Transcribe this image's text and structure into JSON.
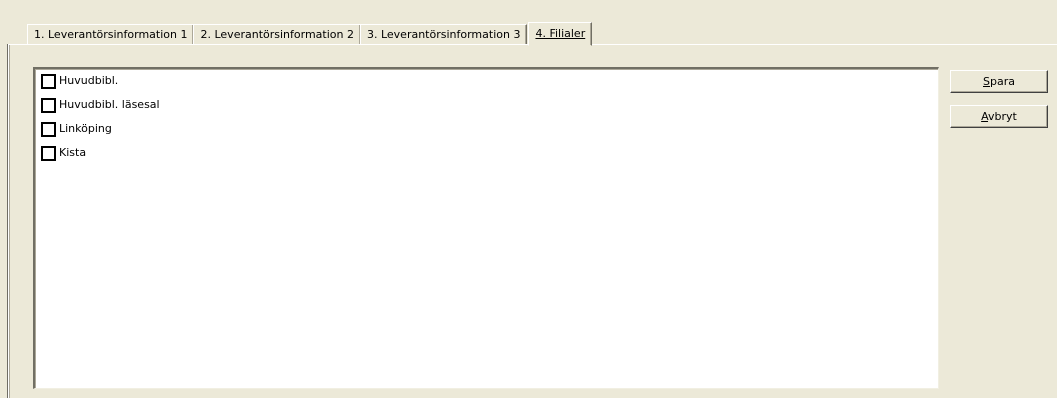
{
  "tabs": [
    {
      "label": "1. Leverantörsinformation 1",
      "active": false
    },
    {
      "label": "2. Leverantörsinformation 2",
      "active": false
    },
    {
      "label": "3. Leverantörsinformation 3",
      "active": false
    },
    {
      "label": "4. Filialer",
      "active": true
    }
  ],
  "branches": [
    {
      "label": "Huvudbibl.",
      "checked": false
    },
    {
      "label": "Huvudbibl. läsesal",
      "checked": false
    },
    {
      "label": "Linköping",
      "checked": false
    },
    {
      "label": "Kista",
      "checked": false
    }
  ],
  "buttons": {
    "save": {
      "accel": "S",
      "rest": "para"
    },
    "cancel": {
      "accel": "A",
      "rest": "vbryt"
    }
  }
}
